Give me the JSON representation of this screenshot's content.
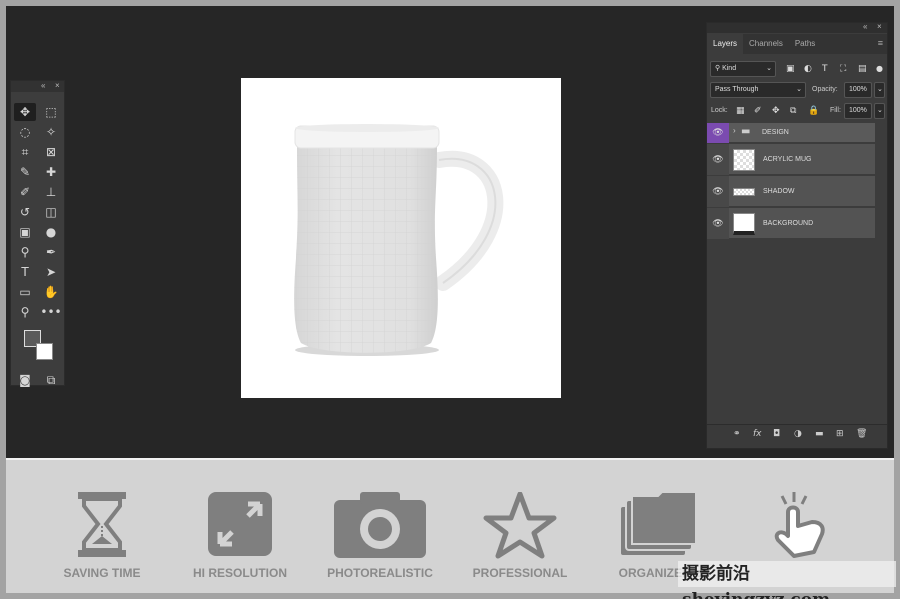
{
  "tools_panel": {
    "collapse": "«",
    "close": "×",
    "tools": [
      {
        "name": "move-tool",
        "glyph": "✥",
        "selected": true
      },
      {
        "name": "marquee-tool",
        "glyph": "⬚"
      },
      {
        "name": "lasso-tool",
        "glyph": "◌"
      },
      {
        "name": "magic-wand-tool",
        "glyph": "✧"
      },
      {
        "name": "crop-tool",
        "glyph": "⌗"
      },
      {
        "name": "frame-tool",
        "glyph": "⊠"
      },
      {
        "name": "eyedropper-tool",
        "glyph": "✎"
      },
      {
        "name": "healing-tool",
        "glyph": "✚"
      },
      {
        "name": "brush-tool",
        "glyph": "✐"
      },
      {
        "name": "stamp-tool",
        "glyph": "⊥"
      },
      {
        "name": "history-brush-tool",
        "glyph": "↺"
      },
      {
        "name": "eraser-tool",
        "glyph": "◫"
      },
      {
        "name": "gradient-tool",
        "glyph": "▣"
      },
      {
        "name": "blur-tool",
        "glyph": "●"
      },
      {
        "name": "dodge-tool",
        "glyph": "⚲"
      },
      {
        "name": "pen-tool",
        "glyph": "✒"
      },
      {
        "name": "type-tool",
        "glyph": "T"
      },
      {
        "name": "path-select-tool",
        "glyph": "➤"
      },
      {
        "name": "rectangle-tool",
        "glyph": "▭"
      },
      {
        "name": "hand-tool",
        "glyph": "✋"
      },
      {
        "name": "zoom-tool",
        "glyph": "⚲"
      },
      {
        "name": "more-tools",
        "glyph": "•••"
      },
      {
        "name": "quick-mask",
        "glyph": "◙"
      },
      {
        "name": "screen-mode",
        "glyph": "⧉"
      }
    ]
  },
  "layers_panel": {
    "collapse": "«",
    "close": "×",
    "menu": "≡",
    "tabs": [
      "Layers",
      "Channels",
      "Paths"
    ],
    "filter_kind": "Kind",
    "blend_mode": "Pass Through",
    "opacity_label": "Opacity:",
    "opacity_value": "100%",
    "lock_label": "Lock:",
    "fill_label": "Fill:",
    "fill_value": "100%",
    "layers": [
      {
        "name": "DESIGN",
        "type": "group",
        "selected": true
      },
      {
        "name": "ACRYLIC MUG",
        "type": "smart"
      },
      {
        "name": "SHADOW",
        "type": "shadow"
      },
      {
        "name": "BACKGROUND",
        "type": "background"
      }
    ]
  },
  "features": [
    {
      "label": "SAVING TIME",
      "icon": "hourglass-icon"
    },
    {
      "label": "HI RESOLUTION",
      "icon": "expand-icon"
    },
    {
      "label": "PHOTOREALISTIC",
      "icon": "camera-icon"
    },
    {
      "label": "PROFESSIONAL",
      "icon": "star-icon"
    },
    {
      "label": "ORGANIZED L",
      "icon": "folders-icon"
    },
    {
      "label": "",
      "icon": "tap-hand-icon"
    }
  ],
  "watermark": "摄影前沿 sheyingzyz.com",
  "colors": {
    "accent_purple": "#7b4bb0",
    "workspace": "#262626",
    "panel": "#3c3c3c",
    "feature_gray": "#808080"
  }
}
